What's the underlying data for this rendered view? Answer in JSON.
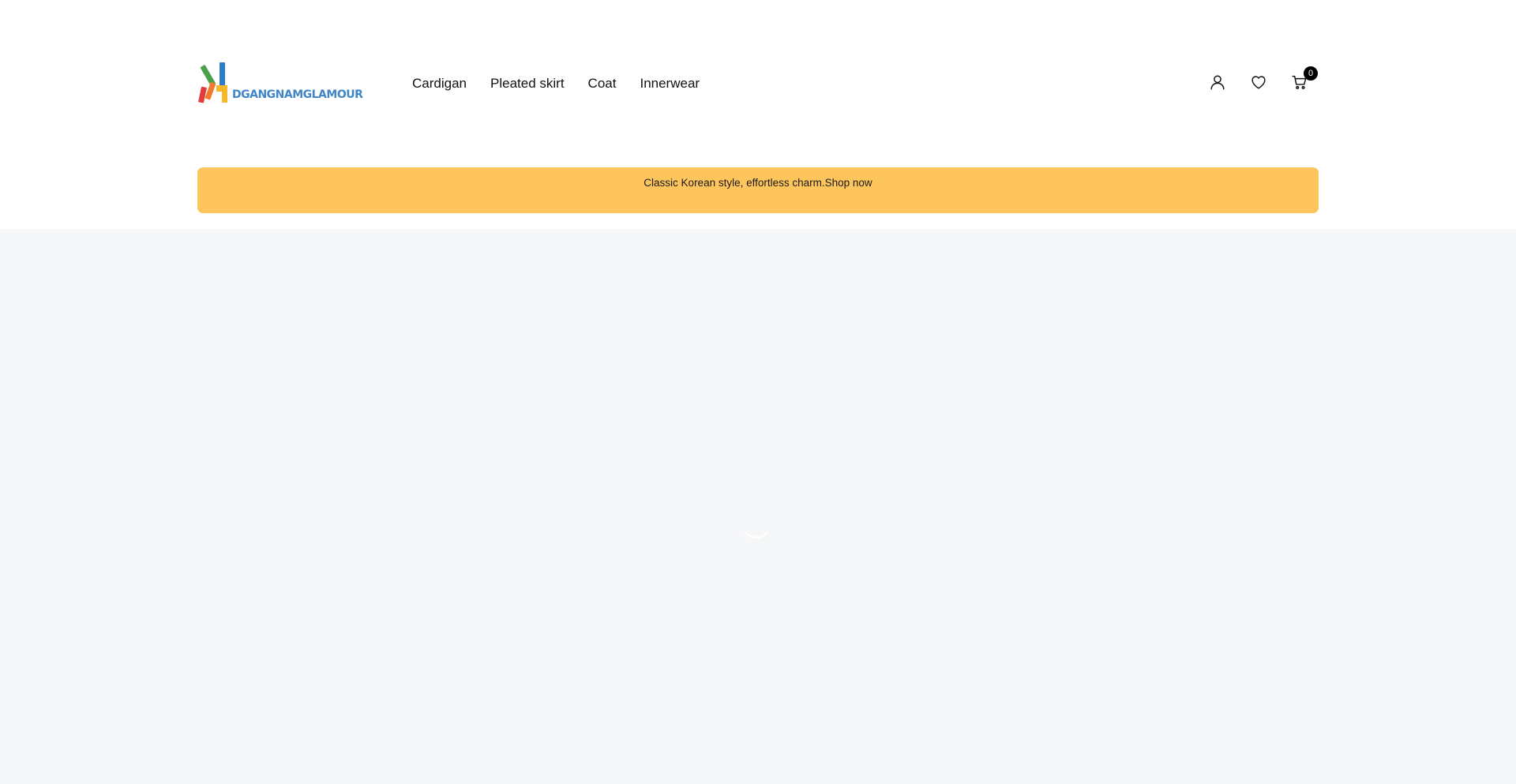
{
  "brand": {
    "name": "DGANGNAMGLAMOUR",
    "colors": {
      "text": "#3f86c9",
      "bar_green": "#4aa14a",
      "bar_blue": "#2f7dc4",
      "bar_red": "#e23b3b",
      "bar_orange": "#f07b2e",
      "bar_yellow": "#f5b82a"
    }
  },
  "nav": {
    "items": [
      {
        "label": "Cardigan"
      },
      {
        "label": "Pleated skirt"
      },
      {
        "label": "Coat"
      },
      {
        "label": "Innerwear"
      }
    ]
  },
  "actions": {
    "account_icon": "user-icon",
    "wishlist_icon": "heart-icon",
    "cart_icon": "cart-icon",
    "cart_count": "0"
  },
  "banner": {
    "text": "Classic Korean style, effortless charm.",
    "link_label": "Shop now",
    "color": "#ffc55d"
  },
  "content": {
    "background": "#f6f7f9",
    "loading_icon": "loading-spinner-icon"
  }
}
